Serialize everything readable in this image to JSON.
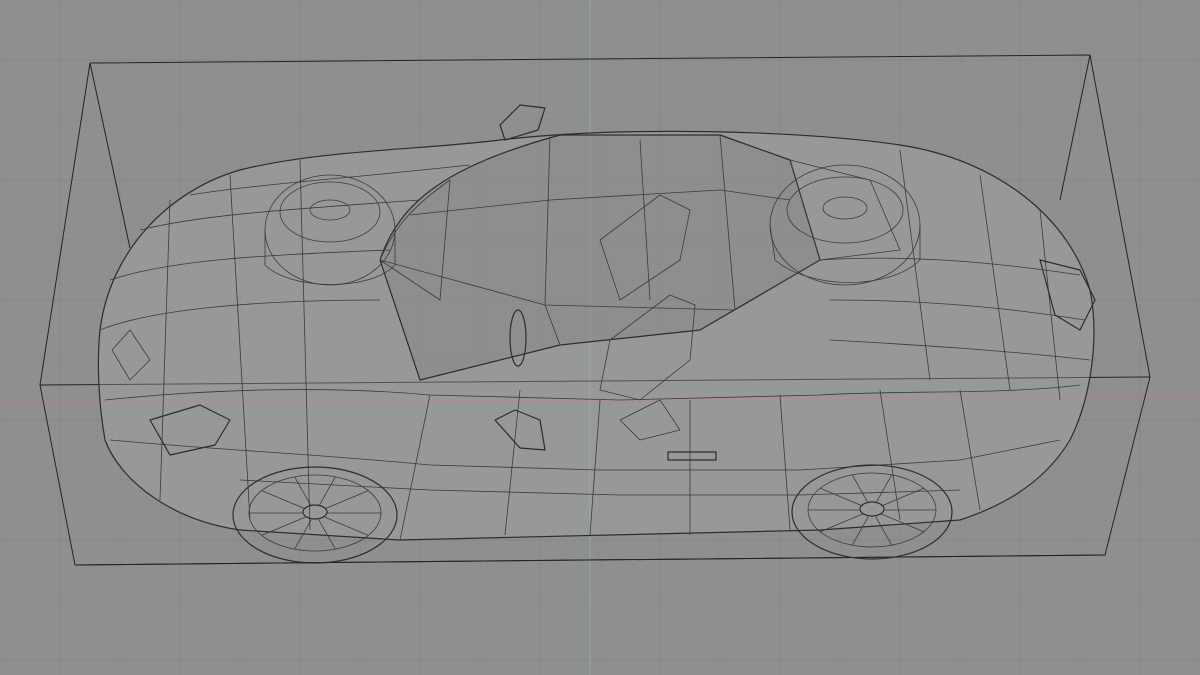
{
  "viewport": {
    "background_color": "#8e8f90",
    "grid_color": "#878889",
    "x_axis_color": "#c07a7e",
    "y_axis_color": "#9aab8a",
    "wire_color": "#3a3b3c",
    "bounding_box_color": "#232425"
  },
  "scene": {
    "object": "car-model",
    "display_mode": "wireframe-xray",
    "bounding_box_visible": true,
    "grid_visible": true
  }
}
